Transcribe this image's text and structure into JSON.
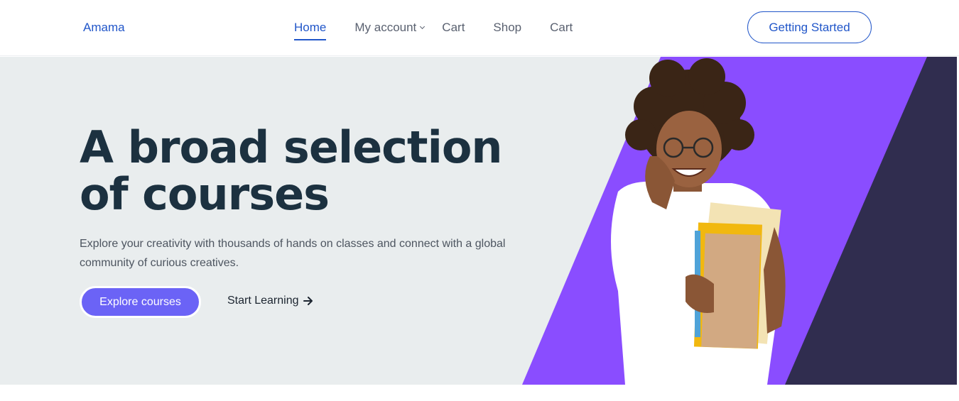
{
  "header": {
    "logo": "Amama",
    "nav": [
      {
        "label": "Home",
        "active": true
      },
      {
        "label": "My account",
        "dropdown": true
      },
      {
        "label": "Cart"
      },
      {
        "label": "Shop"
      },
      {
        "label": "Cart"
      }
    ],
    "cta": "Getting Started"
  },
  "hero": {
    "title": "A broad selection of courses",
    "description": "Explore your creativity with thousands of hands on classes  and connect with a global community of curious creatives.",
    "primary_button": "Explore courses",
    "secondary_link": "Start Learning",
    "secondary_icon": "arrow-right-icon"
  },
  "colors": {
    "brand_blue": "#2156c9",
    "hero_bg": "#e9edee",
    "purple": "#8a4dff",
    "dark_navy": "#302d4f",
    "button_purple": "#6b63f6",
    "title": "#1c3140"
  }
}
